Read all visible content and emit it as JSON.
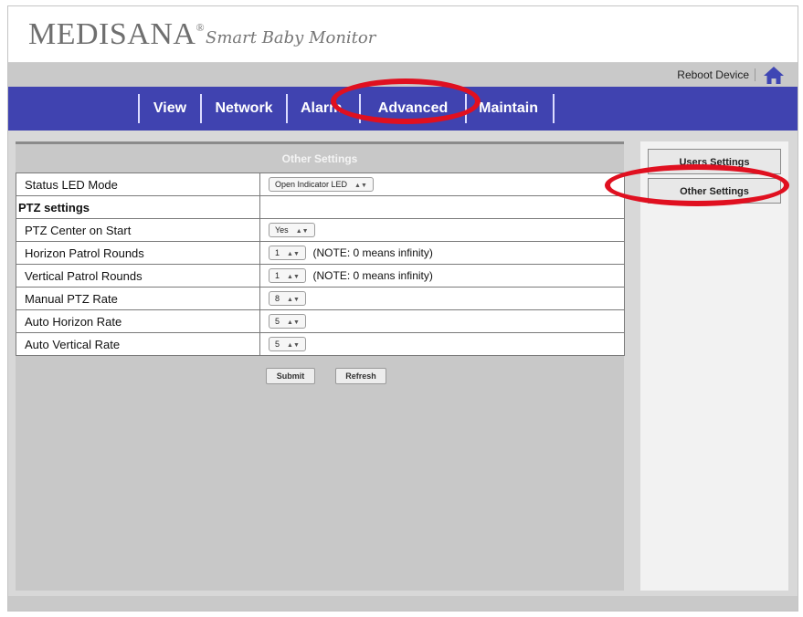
{
  "header": {
    "brand": "MEDISANA",
    "brand_mark": "®",
    "tagline": "Smart Baby Monitor"
  },
  "top_bar": {
    "reboot_label": "Reboot Device",
    "home_icon": "home-icon"
  },
  "nav": {
    "items": [
      {
        "label": "View"
      },
      {
        "label": "Network"
      },
      {
        "label": "Alarm"
      },
      {
        "label": "Advanced"
      },
      {
        "label": "Maintain"
      }
    ],
    "active": "Advanced"
  },
  "panel": {
    "title": "Other Settings",
    "rows": [
      {
        "label": "Status LED Mode",
        "value": "Open Indicator LED",
        "note": ""
      },
      {
        "label": "PTZ settings",
        "value": "",
        "note": ""
      },
      {
        "label": "PTZ Center on Start",
        "value": "Yes",
        "note": ""
      },
      {
        "label": "Horizon Patrol Rounds",
        "value": "1",
        "note": "(NOTE: 0 means infinity)"
      },
      {
        "label": "Vertical Patrol Rounds",
        "value": "1",
        "note": "(NOTE: 0 means infinity)"
      },
      {
        "label": "Manual PTZ Rate",
        "value": "8",
        "note": ""
      },
      {
        "label": "Auto Horizon Rate",
        "value": "5",
        "note": ""
      },
      {
        "label": "Auto Vertical Rate",
        "value": "5",
        "note": ""
      }
    ],
    "submit_label": "Submit",
    "refresh_label": "Refresh"
  },
  "sidebar": {
    "items": [
      {
        "label": "Users Settings"
      },
      {
        "label": "Other Settings"
      }
    ],
    "active": "Other Settings"
  },
  "colors": {
    "nav_bg": "#4043b0",
    "highlight": "#e01020",
    "panel_bg": "#c8c8c8"
  }
}
